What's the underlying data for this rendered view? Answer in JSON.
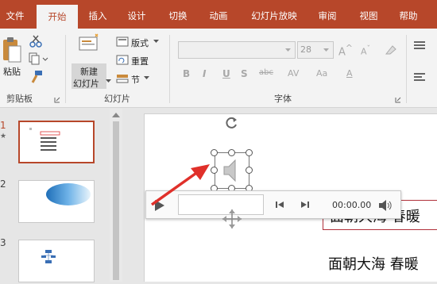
{
  "tabs": [
    "文件",
    "开始",
    "插入",
    "设计",
    "切换",
    "动画",
    "幻灯片放映",
    "审阅",
    "视图",
    "帮助"
  ],
  "clipboard": {
    "paste_label": "粘贴",
    "group_label": "剪贴板"
  },
  "slides_group": {
    "new_slide_line1": "新建",
    "new_slide_line2": "幻灯片",
    "layout_label": "版式",
    "reset_label": "重置",
    "section_label": "节",
    "group_label": "幻灯片"
  },
  "font_group": {
    "font_size_value": "28",
    "group_label": "字体",
    "bold": "B",
    "italic": "I",
    "underline": "U",
    "strike": "S",
    "abc": "abc"
  },
  "thumbnails": {
    "numbers": [
      "1",
      "2",
      "3"
    ],
    "star": "★"
  },
  "player": {
    "time": "00:00.00"
  },
  "slide_text": {
    "line1": "面朝大海 春暖",
    "line2": "面朝大海 春暖"
  },
  "colors": {
    "accent": "#b7472a",
    "arrow": "#e0302a"
  }
}
